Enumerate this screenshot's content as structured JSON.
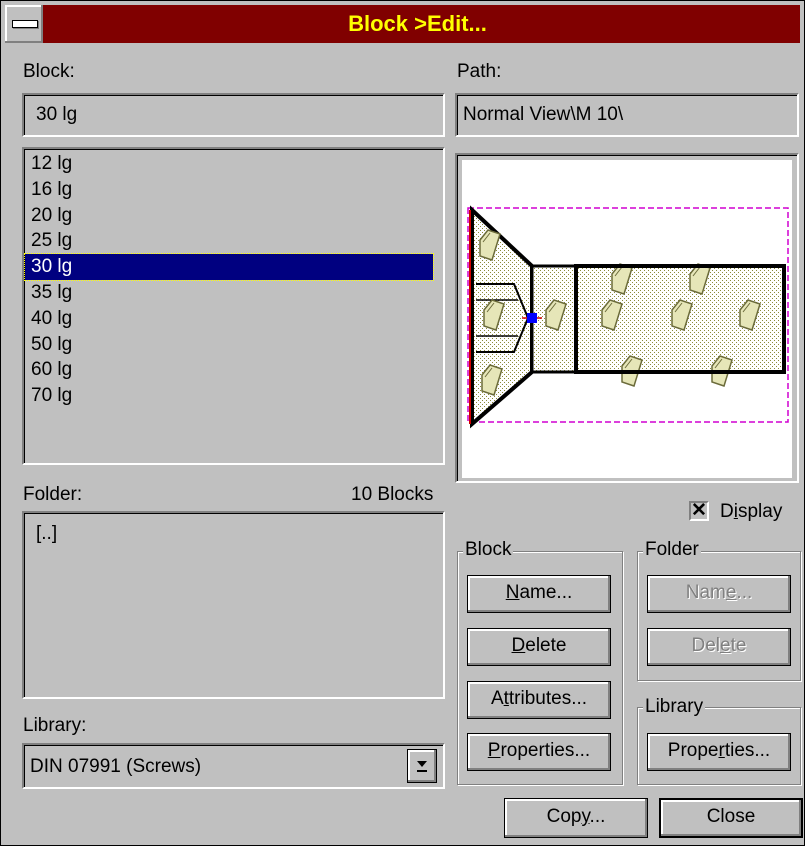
{
  "window": {
    "title": "Block >Edit..."
  },
  "block_label": "Block:",
  "block_value": "30 lg",
  "path_label": "Path:",
  "path_value": "Normal View\\M 10\\",
  "blocks": [
    "12 lg",
    "16 lg",
    "20 lg",
    "25 lg",
    "30 lg",
    "35 lg",
    "40 lg",
    "50 lg",
    "60 lg",
    "70 lg"
  ],
  "selected_block": "30 lg",
  "folder_label": "Folder:",
  "folder_count": "10 Blocks",
  "folders": [
    "[..]"
  ],
  "library_label": "Library:",
  "library_value": "DIN 07991 (Screws)",
  "display": {
    "label_pre": "D",
    "label_ul": "i",
    "label_post": "splay",
    "checked": true,
    "mark": "✕"
  },
  "block_group": {
    "label": "Block",
    "name": {
      "pre": "",
      "ul": "N",
      "post": "ame..."
    },
    "delete": {
      "pre": "",
      "ul": "D",
      "post": "elete"
    },
    "attributes": {
      "pre": "A",
      "ul": "t",
      "post": "tributes..."
    },
    "properties": {
      "pre": "",
      "ul": "P",
      "post": "roperties..."
    }
  },
  "folder_group": {
    "label": "Folder",
    "name": {
      "pre": "Nam",
      "ul": "e",
      "post": "..."
    },
    "delete": {
      "pre": "Del",
      "ul": "e",
      "post": "te"
    }
  },
  "library_group": {
    "label": "Library",
    "properties": {
      "pre": "Prope",
      "ul": "r",
      "post": "ties..."
    }
  },
  "buttons": {
    "copy": {
      "pre": "Cop",
      "ul": "y",
      "post": "..."
    },
    "close": "Close"
  },
  "colors": {
    "title_bg": "#800000",
    "title_fg": "#ffff00",
    "selection": "#000080",
    "face": "#c0c0c0"
  }
}
